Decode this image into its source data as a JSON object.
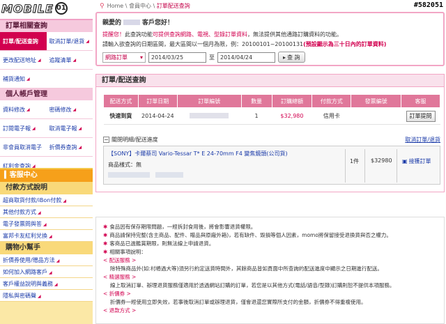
{
  "logo": {
    "text": "MOBILE",
    "num": "01"
  },
  "sidebar": {
    "order_section": "訂單相關查詢",
    "order_rows": [
      [
        {
          "label": "訂單/配送查詢",
          "active": true
        },
        {
          "label": "取消訂單/退貨",
          "active": false
        }
      ],
      [
        {
          "label": "更改配送地址",
          "active": false
        },
        {
          "label": "追蹤清單",
          "active": false
        }
      ],
      [
        {
          "label": "補貨通知",
          "active": false
        }
      ]
    ],
    "account_section": "個人帳戶管理",
    "account_rows": [
      [
        {
          "label": "資料修改"
        },
        {
          "label": "密碼修改"
        }
      ],
      [
        {
          "label": "訂閱電子報"
        },
        {
          "label": "取消電子報"
        }
      ],
      [
        {
          "label": "非會員取消電子"
        },
        {
          "label": "折價券查詢"
        }
      ],
      [
        {
          "label": "紅利金查詢"
        }
      ]
    ],
    "service_center": "客服中心",
    "payment_section": "付款方式說明",
    "payment_items": [
      "超商取貨付款/iBon付款",
      "其他付款方式",
      "電子發票問與答",
      "富邦卡友紅利兌換"
    ],
    "helper_section": "購物小幫手",
    "helper_items": [
      "折價券使用/贈品方法",
      "如何加入網路客戶",
      "客戶權益說明與義務",
      "隱私與密碼聲"
    ]
  },
  "breadcrumb": {
    "home": "Home",
    "sep": "\\",
    "member": "會員中心",
    "current": "訂單配送查詢"
  },
  "ticket": "#582051",
  "query": {
    "greet_prefix": "親愛的",
    "greet_suffix": "客戶您好！",
    "note1_lead": "提醒您！",
    "note1_mid": "此查詢功能",
    "note1_red": "可提供查詢網路、電視、型錄訂單資料",
    "note1_tail": "，無法提供其他通路訂購資料的功能。",
    "note2_lead": "請輸入欲查詢的日期區間，最大區間以一個月為限，例：20100101~20100131",
    "note2_red": "(預設顯示為三十日內的訂單資料)",
    "select_value": "網路訂單",
    "date_from": "2014/03/25",
    "date_to_label": "至",
    "date_to": "2014/04/24",
    "query_btn": "查 詢"
  },
  "orders": {
    "title": "訂單/配送查詢",
    "headers": [
      "配送方式",
      "訂單日期",
      "訂單編號",
      "數量",
      "訂購總額",
      "付款方式",
      "發票編號",
      "客服"
    ],
    "row": {
      "ship": "快速到貨",
      "date": "2014-04-24",
      "qty": "1",
      "total": "$32,980",
      "pay": "信用卡",
      "service_btn": "訂單提問"
    },
    "detail_toggle": "關閉明細/配送進度",
    "cancel_link": "取消訂單/退貨",
    "product": "【SONY】卡爾蔡司 Vario-Tessar T* E 24-70mm F4 變焦鏡頭(公司貨)",
    "spec": "商品樣式：無",
    "qty": "1件",
    "price": "$32980",
    "return": "接獲訂單"
  },
  "notices": [
    {
      "type": "star",
      "text": "食品因有保存期限問題，一經拆封食用後，將會影響退貨權限。"
    },
    {
      "type": "star",
      "text": "商品請保持完整(含主商品、配件、贈品與原廠外箱)，若有缺件、毀損等個人因素，momo將保留接受退換貨與否之權力。"
    },
    {
      "type": "star",
      "text": "客商品已過鑑賞期限，則無法線上申請退貨。"
    },
    {
      "type": "star",
      "text": "相關事項說明："
    },
    {
      "type": "sub",
      "text": "< 配送服務 >"
    },
    {
      "type": "body",
      "text": "除特殊商品外(如:村樁過大等)須另行約定送貨時間外，其餘商品皆如頁面中所查詢的配送進度中顯示之日期進行配送。"
    },
    {
      "type": "sub",
      "text": "< 精選服務 >"
    },
    {
      "type": "body",
      "text": "線上取消訂單、辦理退貨服務僅適用於透過網站訂購的訂單，若您是以其他方式(電話/語音/型錄)訂購則恕不提供本項服務。"
    },
    {
      "type": "sub",
      "text": "< 折價券 >"
    },
    {
      "type": "body",
      "text": "折價券一經使用立即失效，若事後取消訂單或辦理退貨，僅會退還您實際所支付的金額，折價券不得重複使用。"
    },
    {
      "type": "sub",
      "text": "< 退款方式 >"
    }
  ]
}
